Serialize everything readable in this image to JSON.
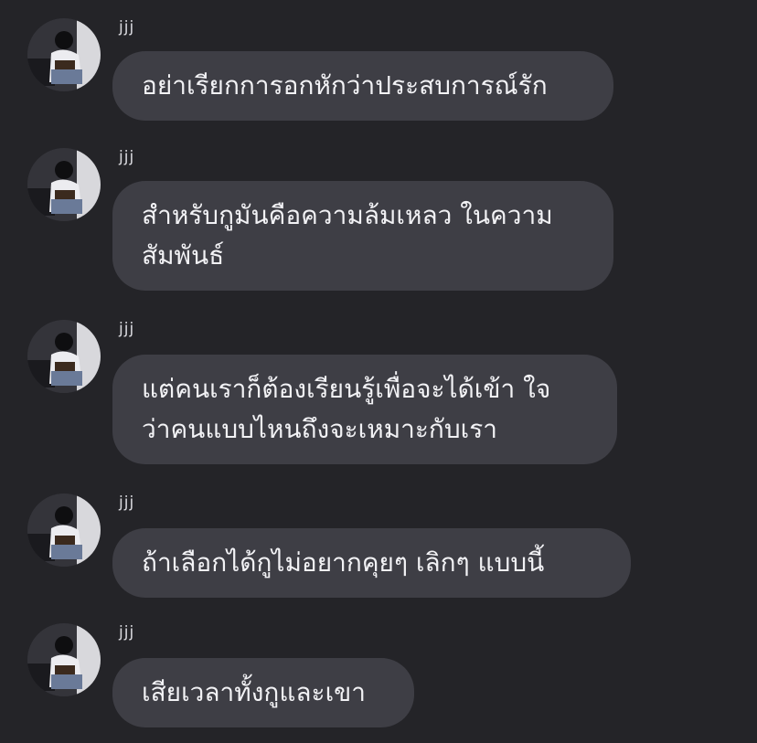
{
  "conversation": {
    "messages": [
      {
        "sender": "jjj",
        "text": "อย่าเรียกการอกหักว่าประสบการณ์รัก"
      },
      {
        "sender": "jjj",
        "text": "สำหรับกูมันคือความล้มเหลว ในความ\nสัมพันธ์"
      },
      {
        "sender": "jjj",
        "text": "แต่คนเราก็ต้องเรียนรู้เพื่อจะได้เข้า ใจ\nว่าคนแบบไหนถึงจะเหมาะกับเรา"
      },
      {
        "sender": "jjj",
        "text": "ถ้าเลือกได้กูไม่อยากคุยๆ เลิกๆ แบบนี้"
      },
      {
        "sender": "jjj",
        "text": "เสียเวลาทั้งกูและเขา"
      }
    ]
  }
}
